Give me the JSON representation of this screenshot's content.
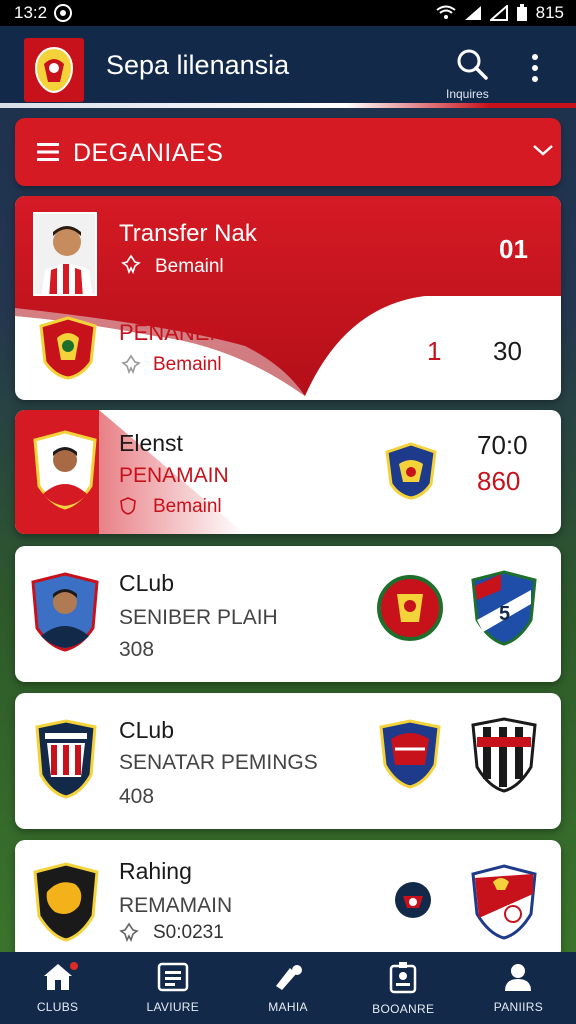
{
  "status_bar": {
    "time": "13:2",
    "right_text": "815"
  },
  "app_bar": {
    "title": "Sepa lilenansia",
    "search_label": "Inquires"
  },
  "filter": {
    "label": "DEGANIAES"
  },
  "colors": {
    "primary_red": "#d51a24",
    "navy": "#13294a",
    "white": "#ffffff"
  },
  "cards": [
    {
      "title": "Transfer Nak",
      "sub": "Bemainl",
      "value": "01",
      "title2": "PENANEN",
      "sub2": "Bemainl",
      "value2a": "1",
      "value2b": "30"
    },
    {
      "title": "Elenst",
      "line2": "PENAMAIN",
      "sub": "Bemainl",
      "value_top": "70:0",
      "value_bottom": "860"
    },
    {
      "title": "CLub",
      "line2": "SENIBER PLAIH",
      "line3": "308"
    },
    {
      "title": "CLub",
      "line2": "SENATAR PEMINGS",
      "line3": "408"
    },
    {
      "title": "Rahing",
      "line2": "REMAMAIN",
      "line3": "S0:0231"
    }
  ],
  "bottom_nav": [
    {
      "label": "CLUBS",
      "icon": "home-icon"
    },
    {
      "label": "LAVIURE",
      "icon": "league-table-icon"
    },
    {
      "label": "MAHIA",
      "icon": "match-icon"
    },
    {
      "label": "BOOANRE",
      "icon": "id-card-icon"
    },
    {
      "label": "PANIIRS",
      "icon": "profile-icon"
    }
  ]
}
